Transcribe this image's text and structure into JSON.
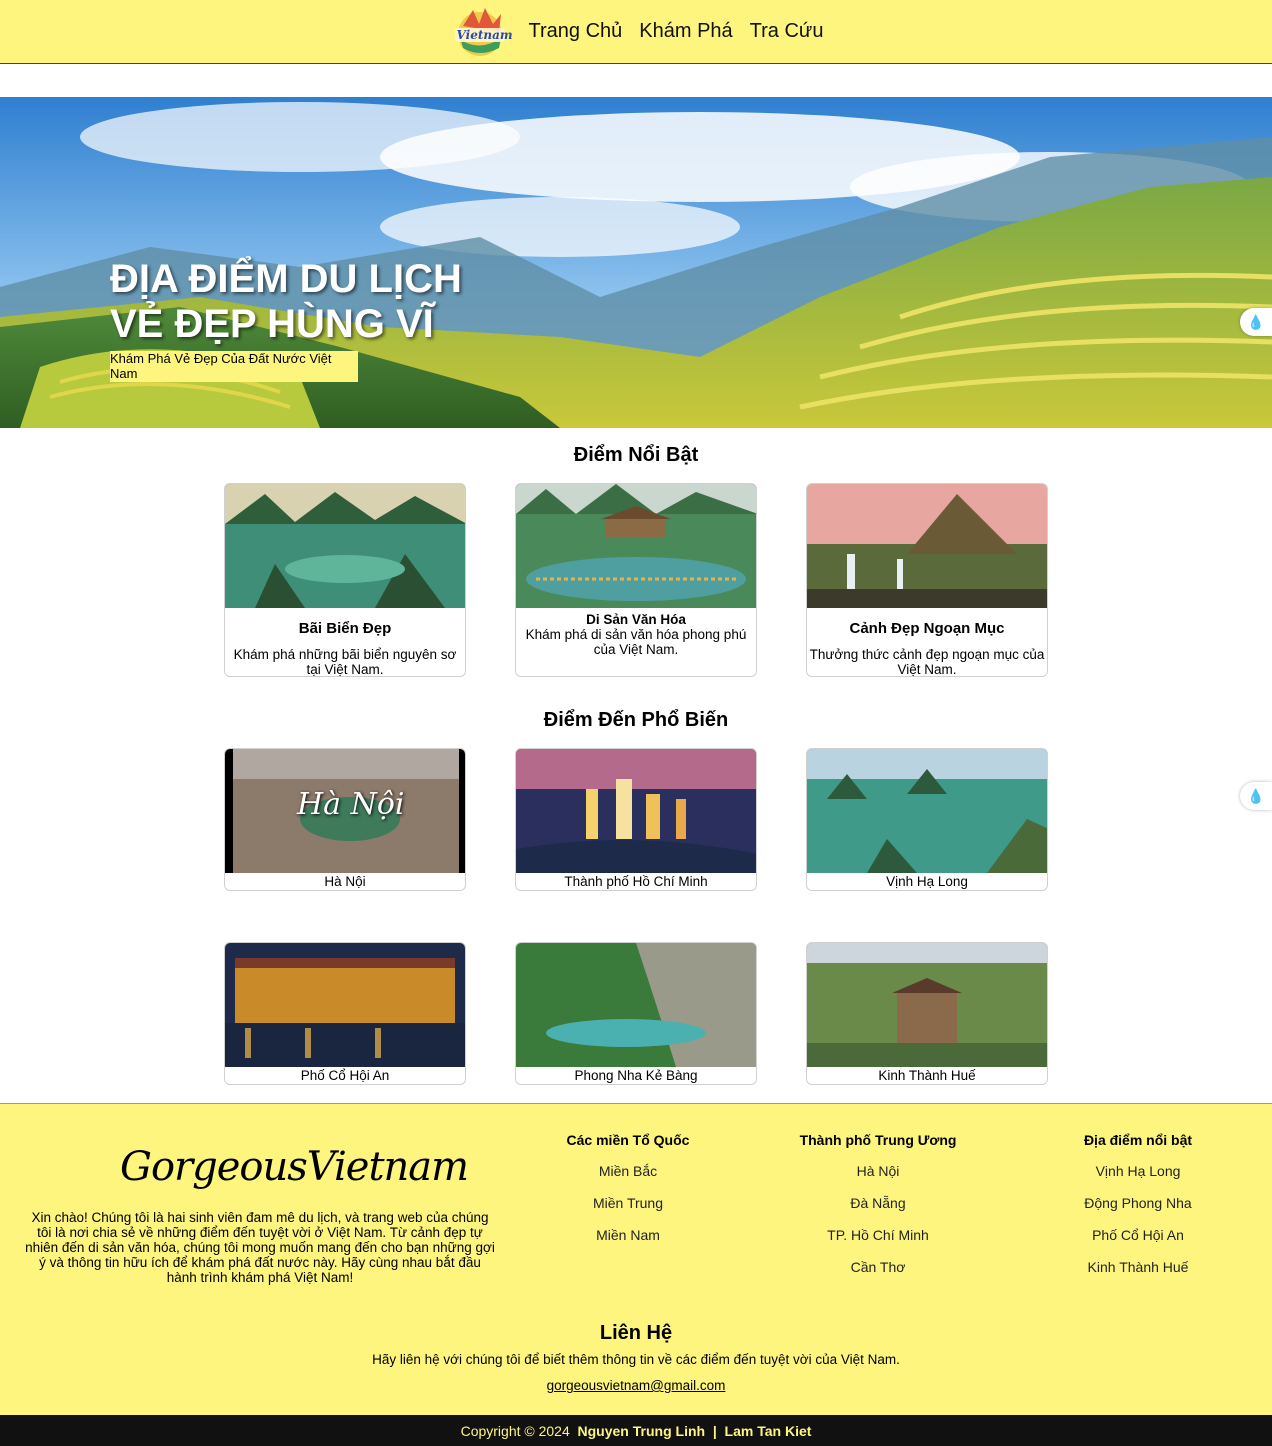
{
  "header": {
    "logo_text": "Vietnam",
    "nav": [
      "Trang Chủ",
      "Khám Phá",
      "Tra Cứu"
    ]
  },
  "hero": {
    "title_line1": "ĐỊA ĐIỂM DU LỊCH",
    "title_line2": "VẺ ĐẸP HÙNG VĨ",
    "subtitle": "Khám Phá Vẻ Đẹp Của Đất Nước Việt Nam"
  },
  "highlights": {
    "title": "Điểm Nổi Bật",
    "cards": [
      {
        "title": "Bãi Biển Đẹp",
        "desc": "Khám phá những bãi biển nguyên sơ tại Việt Nam."
      },
      {
        "title": "Di Sản Văn Hóa",
        "desc": "Khám phá di sản văn hóa phong phú của Việt Nam."
      },
      {
        "title": "Cảnh Đẹp Ngoạn Mục",
        "desc": "Thưởng thức cảnh đẹp ngoạn mục của Việt Nam."
      }
    ]
  },
  "popular": {
    "title": "Điểm Đến Phổ Biến",
    "destinations": [
      "Hà Nội",
      "Thành phố Hồ Chí Minh",
      "Vịnh Hạ Long",
      "Phố Cổ Hội An",
      "Phong Nha Kẻ Bàng",
      "Kinh Thành Huế"
    ],
    "hanoi_overlay": "Hà Nội"
  },
  "footer": {
    "brand": "GorgeousVietnam",
    "about": "Xin chào! Chúng tôi là hai sinh viên đam mê du lịch, và trang web của chúng tôi là nơi chia sẻ về những điểm đến tuyệt vời ở Việt Nam. Từ cảnh đẹp tự nhiên đến di sản văn hóa, chúng tôi mong muốn mang đến cho bạn những gợi ý và thông tin hữu ích để khám phá đất nước này. Hãy cùng nhau bắt đầu hành trình khám phá Việt Nam!",
    "columns": [
      {
        "title": "Các miền Tổ Quốc",
        "links": [
          "Miền Bắc",
          "Miền Trung",
          "Miền Nam"
        ]
      },
      {
        "title": "Thành phố Trung Ương",
        "links": [
          "Hà Nội",
          "Đà Nẵng",
          "TP. Hồ Chí Minh",
          "Cần Thơ"
        ]
      },
      {
        "title": "Địa điểm nổi bật",
        "links": [
          "Vịnh Hạ Long",
          "Động Phong Nha",
          "Phố Cổ Hội An",
          "Kinh Thành Huế"
        ]
      }
    ],
    "contact_title": "Liên Hệ",
    "contact_text": "Hãy liên hệ với chúng tôi để biết thêm thông tin về các điểm đến tuyệt vời của Việt Nam.",
    "email": "gorgeousvietnam@gmail.com"
  },
  "copyright": {
    "prefix": "Copyright © 2024",
    "author1": "Nguyen Trung Linh",
    "separator": "|",
    "author2": "Lam Tan Kiet"
  },
  "colors": {
    "accent": "#fdf57e",
    "dark": "#111111"
  },
  "icons": [
    "droplet-sparkle-icon"
  ]
}
